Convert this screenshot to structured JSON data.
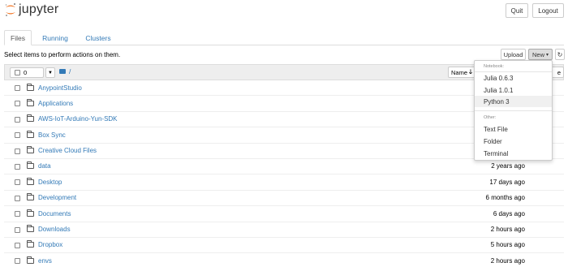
{
  "header": {
    "app_name": "jupyter",
    "quit_label": "Quit",
    "logout_label": "Logout"
  },
  "tabs": [
    {
      "label": "Files",
      "active": true
    },
    {
      "label": "Running",
      "active": false
    },
    {
      "label": "Clusters",
      "active": false
    }
  ],
  "toolbar": {
    "select_message": "Select items to perform actions on them.",
    "upload_label": "Upload",
    "new_label": "New",
    "refresh_icon": "refresh-icon"
  },
  "list_header": {
    "selected_count": "0",
    "path": "/",
    "name_sort_label": "Name",
    "last_modified_label": "e"
  },
  "rows": [
    {
      "name": "AnypointStudio",
      "modified": ""
    },
    {
      "name": "Applications",
      "modified": ""
    },
    {
      "name": "AWS-IoT-Arduino-Yun-SDK",
      "modified": ""
    },
    {
      "name": "Box Sync",
      "modified": ""
    },
    {
      "name": "Creative Cloud Files",
      "modified": ""
    },
    {
      "name": "data",
      "modified": "2 years ago"
    },
    {
      "name": "Desktop",
      "modified": "17 days ago"
    },
    {
      "name": "Development",
      "modified": "6 months ago"
    },
    {
      "name": "Documents",
      "modified": "6 days ago"
    },
    {
      "name": "Downloads",
      "modified": "2 hours ago"
    },
    {
      "name": "Dropbox",
      "modified": "5 hours ago"
    },
    {
      "name": "envs",
      "modified": "2 hours ago"
    }
  ],
  "new_menu": {
    "notebook_header": "Notebook:",
    "notebook_items": [
      "Julia 0.6.3",
      "Julia 1.0.1",
      "Python 3"
    ],
    "other_header": "Other:",
    "other_items": [
      "Text File",
      "Folder",
      "Terminal"
    ]
  },
  "colors": {
    "link": "#337ab7",
    "logo_orange": "#f37726"
  }
}
